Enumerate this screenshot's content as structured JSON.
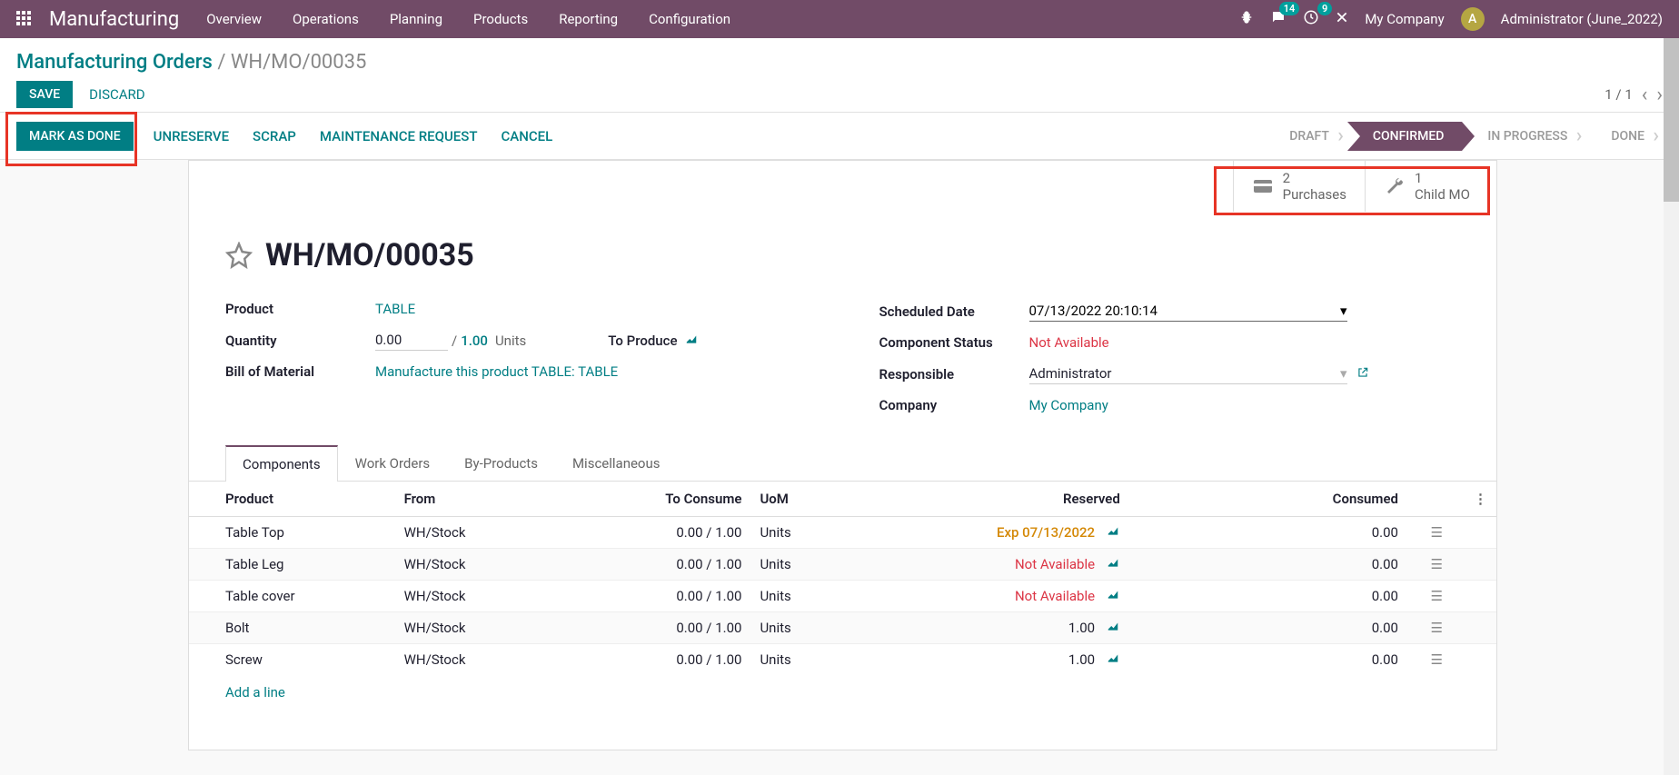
{
  "topnav": {
    "brand": "Manufacturing",
    "menu": [
      "Overview",
      "Operations",
      "Planning",
      "Products",
      "Reporting",
      "Configuration"
    ],
    "chat_badge": "14",
    "clock_badge": "9",
    "company": "My Company",
    "user": "Administrator (June_2022)",
    "avatar_letter": "A"
  },
  "breadcrumb": {
    "root": "Manufacturing Orders",
    "leaf": "WH/MO/00035"
  },
  "actions": {
    "save": "SAVE",
    "discard": "DISCARD",
    "pager": "1 / 1"
  },
  "statusbar": {
    "mark_done": "MARK AS DONE",
    "unreserve": "UNRESERVE",
    "scrap": "SCRAP",
    "maintenance": "MAINTENANCE REQUEST",
    "cancel": "CANCEL",
    "steps": [
      "DRAFT",
      "CONFIRMED",
      "IN PROGRESS",
      "DONE"
    ],
    "active_idx": 1
  },
  "statbuttons": {
    "purchases": {
      "count": "2",
      "label": "Purchases"
    },
    "child": {
      "count": "1",
      "label": "Child MO"
    }
  },
  "record": {
    "name": "WH/MO/00035",
    "product_label": "Product",
    "product": "TABLE",
    "quantity_label": "Quantity",
    "qty": "0.00",
    "qty_of": "1.00",
    "uom": "Units",
    "to_produce": "To Produce",
    "bom_label": "Bill of Material",
    "bom": "Manufacture this product TABLE: TABLE",
    "sched_label": "Scheduled Date",
    "sched": "07/13/2022 20:10:14",
    "compstat_label": "Component Status",
    "compstat": "Not Available",
    "resp_label": "Responsible",
    "resp": "Administrator",
    "company_label": "Company",
    "company": "My Company"
  },
  "tabs": [
    "Components",
    "Work Orders",
    "By-Products",
    "Miscellaneous"
  ],
  "table": {
    "headers": {
      "product": "Product",
      "from": "From",
      "to_consume": "To Consume",
      "uom": "UoM",
      "reserved": "Reserved",
      "consumed": "Consumed"
    },
    "rows": [
      {
        "product": "Table Top",
        "from": "WH/Stock",
        "to_consume": "0.00 / 1.00",
        "uom": "Units",
        "reserved": "Exp 07/13/2022",
        "reserved_class": "orange",
        "consumed": "0.00"
      },
      {
        "product": "Table Leg",
        "from": "WH/Stock",
        "to_consume": "0.00 / 1.00",
        "uom": "Units",
        "reserved": "Not Available",
        "reserved_class": "red",
        "consumed": "0.00"
      },
      {
        "product": "Table cover",
        "from": "WH/Stock",
        "to_consume": "0.00 / 1.00",
        "uom": "Units",
        "reserved": "Not Available",
        "reserved_class": "red",
        "consumed": "0.00"
      },
      {
        "product": "Bolt",
        "from": "WH/Stock",
        "to_consume": "0.00 / 1.00",
        "uom": "Units",
        "reserved": "1.00",
        "reserved_class": "",
        "consumed": "0.00"
      },
      {
        "product": "Screw",
        "from": "WH/Stock",
        "to_consume": "0.00 / 1.00",
        "uom": "Units",
        "reserved": "1.00",
        "reserved_class": "",
        "consumed": "0.00"
      }
    ],
    "add_line": "Add a line"
  }
}
